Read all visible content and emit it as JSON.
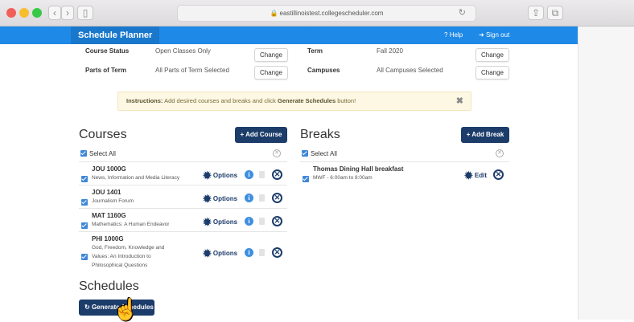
{
  "browser": {
    "url": "eastillinoistest.collegescheduler.com",
    "back": "‹",
    "forward": "›",
    "sidebar": "▯",
    "reload": "↻",
    "share": "⇪",
    "tabs": "⧉"
  },
  "header": {
    "brand": "Schedule Planner",
    "help": "Help",
    "signout": "Sign out"
  },
  "filters": {
    "course_status_label": "Course Status",
    "course_status_value": "Open Classes Only",
    "term_label": "Term",
    "term_value": "Fall 2020",
    "parts_label": "Parts of Term",
    "parts_value": "All Parts of Term Selected",
    "campuses_label": "Campuses",
    "campuses_value": "All Campuses Selected",
    "change_label": "Change"
  },
  "instructions": {
    "label": "Instructions:",
    "text1": "Add desired courses and breaks and click",
    "text2": "Generate Schedules",
    "text3": "button!",
    "close": "✖"
  },
  "courses": {
    "title": "Courses",
    "add_label": "+ Add Course",
    "select_all": "Select All",
    "options_label": "Options",
    "items": [
      {
        "code": "JOU 1000G",
        "name": "News, Information and Media Literacy"
      },
      {
        "code": "JOU 1401",
        "name": "Journalism Forum"
      },
      {
        "code": "MAT 1160G",
        "name": "Mathematics: A Human Endeavor"
      },
      {
        "code": "PHI 1000G",
        "name1": "God, Freedom, Knowledge and",
        "name2": "Values: An Introduction to",
        "name3": "Philosophical Questions"
      }
    ]
  },
  "breaks": {
    "title": "Breaks",
    "add_label": "+ Add Break",
    "select_all": "Select All",
    "edit_label": "Edit",
    "items": [
      {
        "name": "Thomas Dining Hall breakfast",
        "time": "MWF - 6:00am to 8:00am"
      }
    ]
  },
  "schedules": {
    "title": "Schedules",
    "generate_label": "Generate Schedules",
    "generate_icon": "↻"
  },
  "icons": {
    "gear": "✹",
    "info": "i",
    "delete": "✕",
    "clear": "✕",
    "help": "?",
    "signout": "➜"
  },
  "colors": {
    "appbar": "#1e89e6",
    "navy_button": "#1c3c6a",
    "instructions_bg": "#fcf8e3"
  }
}
